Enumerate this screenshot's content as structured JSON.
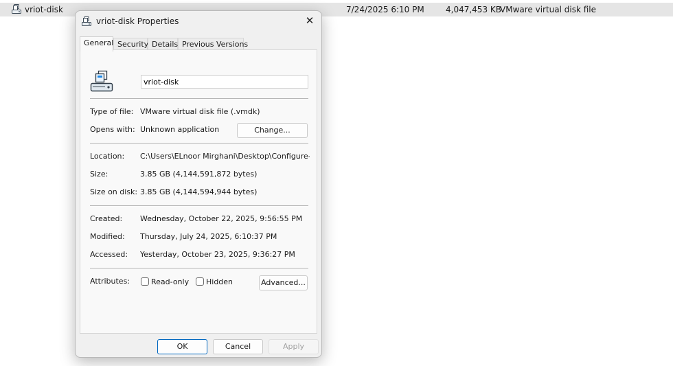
{
  "explorer_row": {
    "name": "vriot-disk",
    "date_modified": "7/24/2025 6:10 PM",
    "size": "4,047,453 KB",
    "type": "VMware virtual disk file",
    "icon": "vmdk-file-icon"
  },
  "dialog": {
    "title": "vriot-disk Properties",
    "close_glyph": "✕",
    "tabs": [
      {
        "label": "General"
      },
      {
        "label": "Security"
      },
      {
        "label": "Details"
      },
      {
        "label": "Previous Versions"
      }
    ],
    "active_tab": "General",
    "general": {
      "file_name": "vriot-disk",
      "type_label": "Type of file:",
      "type_value": "VMware virtual disk file (.vmdk)",
      "opens_label": "Opens with:",
      "opens_value": "Unknown application",
      "change_label": "Change...",
      "location_label": "Location:",
      "location_value": "C:\\Users\\ELnoor Mirghani\\Desktop\\Configure-Roza",
      "size_label": "Size:",
      "size_value": "3.85 GB (4,144,591,872 bytes)",
      "size_on_disk_label": "Size on disk:",
      "size_on_disk_value": "3.85 GB (4,144,594,944 bytes)",
      "created_label": "Created:",
      "created_value": "Wednesday, October 22, 2025, 9:56:55 PM",
      "modified_label": "Modified:",
      "modified_value": "Thursday, July 24, 2025, 6:10:37 PM",
      "accessed_label": "Accessed:",
      "accessed_value": "Yesterday, October 23, 2025, 9:36:27 PM",
      "attributes_label": "Attributes:",
      "readonly_label": "Read-only",
      "readonly_checked": false,
      "hidden_label": "Hidden",
      "hidden_checked": false,
      "advanced_label": "Advanced..."
    },
    "buttons": {
      "ok": "OK",
      "cancel": "Cancel",
      "apply": "Apply"
    }
  },
  "colors": {
    "accent": "#0067c0",
    "dialog_bg": "#f0f0f0",
    "panel_bg": "#f9f9f9",
    "row_highlight": "#e5e5e5"
  }
}
